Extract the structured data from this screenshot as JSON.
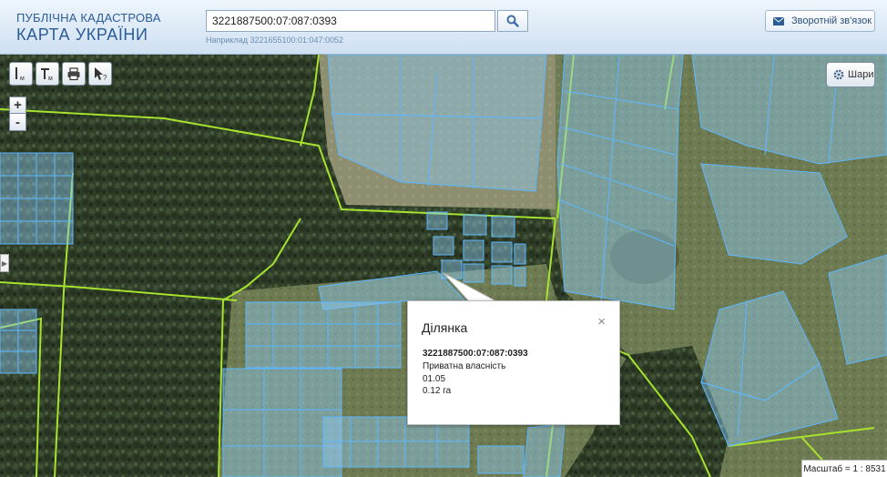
{
  "header": {
    "logo_line1": "ПУБЛІЧНА КАДАСТРОВА",
    "logo_line2": "КАРТА УКРАЇНИ",
    "search_value": "3221887500:07:087:0393",
    "search_hint": "Наприклад 3221655100:01:047:0052",
    "feedback_label": "Зворотній зв'язок",
    "icons": {
      "search": "search-icon",
      "feedback": "envelope-icon"
    }
  },
  "toolbar": {
    "tools": [
      {
        "name": "measure-distance-tool",
        "icon": "ruler-icon",
        "sub": "м"
      },
      {
        "name": "measure-area-tool",
        "icon": "area-icon",
        "sub": "м"
      },
      {
        "name": "print-tool",
        "icon": "printer-icon",
        "sub": ""
      },
      {
        "name": "info-tool",
        "icon": "cursor-question-icon",
        "sub": "?"
      }
    ],
    "zoom_in": "+",
    "zoom_out": "-",
    "layers_label": "Шари",
    "layers_icon": "gear-icon"
  },
  "popup": {
    "title": "Ділянка",
    "close": "×",
    "cadastral_number": "3221887500:07:087:0393",
    "ownership": "Приватна власність",
    "purpose_code": "01.05",
    "area": "0.12 га"
  },
  "scale": {
    "label": "Масштаб = 1 : 8531"
  },
  "colors": {
    "accent": "#2a5d97",
    "parcel_fill": "#8fc9f2",
    "parcel_stroke": "#5db7ff",
    "boundary": "#a6e22e",
    "forest": "#2d3b27",
    "field": "#6b7a4f"
  }
}
